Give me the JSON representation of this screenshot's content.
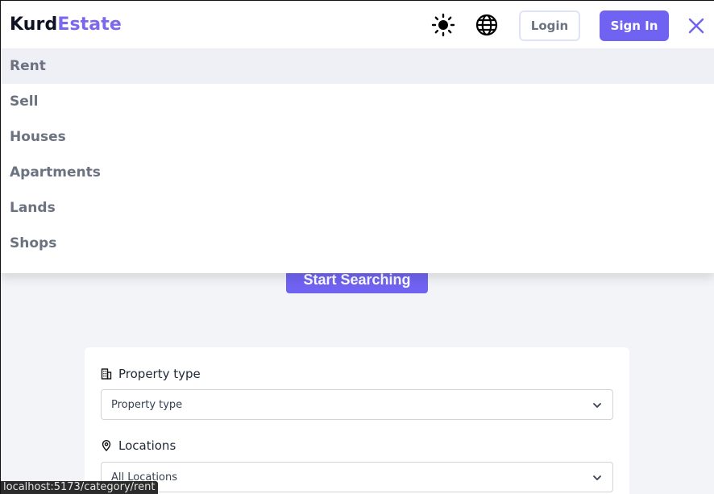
{
  "brand": {
    "part1": "Kurd",
    "part2": "Estate"
  },
  "header": {
    "login_label": "Login",
    "signin_label": "Sign In",
    "theme_icon": "sun-icon",
    "language_icon": "globe-icon",
    "close_icon": "close-icon"
  },
  "menu": {
    "items": [
      {
        "label": "Rent",
        "active": true
      },
      {
        "label": "Sell"
      },
      {
        "label": "Houses"
      },
      {
        "label": "Apartments"
      },
      {
        "label": "Lands"
      },
      {
        "label": "Shops"
      }
    ]
  },
  "main": {
    "start_label": "Start Searching",
    "filters": {
      "property_type": {
        "label": "Property type",
        "value": "Property type",
        "icon": "building-icon"
      },
      "locations": {
        "label": "Locations",
        "value": "All Locations",
        "icon": "location-pin-icon"
      }
    }
  },
  "statusbar": {
    "url": "localhost:5173/category/rent"
  },
  "colors": {
    "accent": "#7063f2",
    "brand_accent": "#7b68ee",
    "muted_text": "#6b7280"
  }
}
